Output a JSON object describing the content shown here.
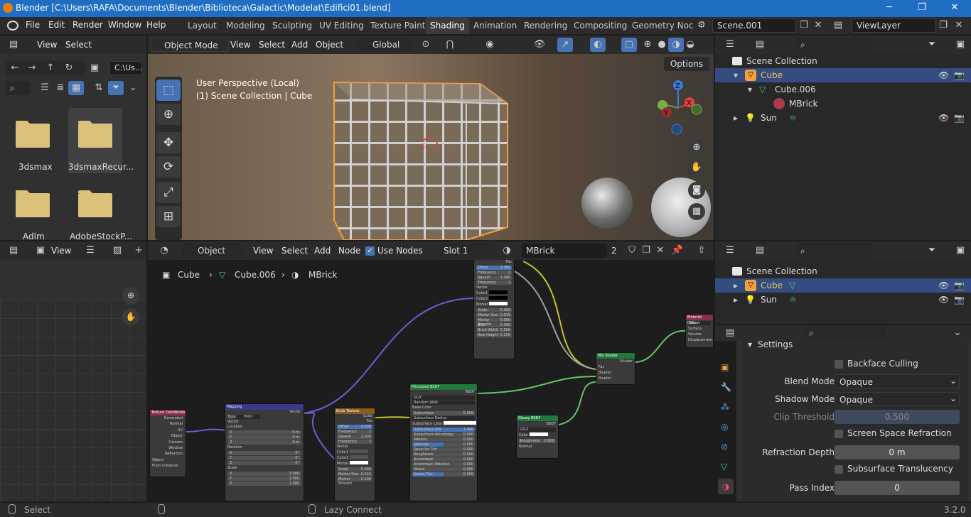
{
  "titlebar": {
    "title": "Blender [C:\\Users\\RAFA\\Documents\\Blender\\Biblioteca\\Galactic\\Modelat\\Edifici01.blend]",
    "minimize": "─",
    "maximize": "❐",
    "close": "✕"
  },
  "menu": [
    "File",
    "Edit",
    "Render",
    "Window",
    "Help"
  ],
  "workspaces": [
    "Layout",
    "Modeling",
    "Sculpting",
    "UV Editing",
    "Texture Paint",
    "Shading",
    "Animation",
    "Rendering",
    "Compositing",
    "Geometry Noc"
  ],
  "active_workspace": "Shading",
  "scene": "Scene.001",
  "viewlayer": "ViewLayer",
  "filebrowser": {
    "view": "View",
    "select": "Select",
    "path": "C:\\Us...",
    "folders": [
      "3dsmax",
      "3dsmaxRecur...",
      "Adlm",
      "AdobeStockP..."
    ]
  },
  "viewport": {
    "mode": "Object Mode",
    "menus": [
      "View",
      "Select",
      "Add",
      "Object"
    ],
    "transform": "Global",
    "options": "Options",
    "info1": "User Perspective (Local)",
    "info2": "(1) Scene Collection | Cube",
    "gizmo": {
      "x": "X",
      "y": "Y",
      "z": "Z"
    }
  },
  "outliner_top": {
    "scene_collection": "Scene Collection",
    "cube": "Cube",
    "mesh": "Cube.006",
    "material": "MBrick",
    "sun": "Sun"
  },
  "outliner_bottom": {
    "scene_collection": "Scene Collection",
    "cube": "Cube",
    "sun": "Sun"
  },
  "image_editor": {
    "view": "View"
  },
  "node_editor": {
    "type": "Object",
    "menus": [
      "View",
      "Select",
      "Add",
      "Node"
    ],
    "use_nodes": "Use Nodes",
    "slot": "Slot 1",
    "material": "MBrick",
    "users": "2",
    "breadcrumb": [
      "Cube",
      "Cube.006",
      "MBrick"
    ]
  },
  "nodes": {
    "texcoord": {
      "title": "Texture Coordinate",
      "rows": [
        "Generated",
        "Normal",
        "UV",
        "Object",
        "Camera",
        "Window",
        "Reflection",
        "Object",
        "From Instancer"
      ]
    },
    "mapping": {
      "title": "Mapping",
      "rows": [
        "Vector",
        "Type",
        "Point",
        "Vector",
        "Location",
        "X",
        "Y",
        "Z",
        "Rotation",
        "X",
        "Y",
        "Z",
        "Scale",
        "X",
        "Y",
        "Z"
      ],
      "vals": [
        "0 m",
        "0 m",
        "0 m",
        "0°",
        "0°",
        "0°",
        "1.000",
        "1.000",
        "1.000"
      ]
    },
    "brick1": {
      "title": "Brick Texture",
      "rows": [
        "Color",
        "Fac",
        "Offset",
        "Frequency",
        "Squash",
        "Frequency",
        "Vector",
        "Color1",
        "Color2",
        "Mortar",
        "Scale",
        "Mortar Size",
        "Mortar Smooth"
      ],
      "vals": [
        "0.500",
        "2",
        "1.000",
        "2",
        "5.000",
        "0.015",
        "0.100"
      ]
    },
    "brick2": {
      "title": "",
      "rows": [
        "Fac",
        "Offset",
        "Frequency",
        "Squash",
        "Frequency",
        "Vector",
        "Color1",
        "Color2",
        "Mortar",
        "Scale",
        "Mortar Size",
        "Mortar Smooth",
        "Bias",
        "Brick Width",
        "Row Height"
      ],
      "vals": [
        "1.000",
        "2",
        "1.000",
        "2",
        "5.000",
        "0.015",
        "0.000",
        "0.000",
        "0.500",
        "0.250"
      ]
    },
    "principled": {
      "title": "Principled BSDF",
      "rows": [
        "BSDF",
        "GGX",
        "Random Walk",
        "Base Color",
        "Subsurface",
        "Subsurface Radius",
        "Subsurface Color",
        "Subsurface IOR",
        "Subsurface Anisotropy",
        "Metallic",
        "Specular",
        "Specular Tint",
        "Roughness",
        "Anisotropic",
        "Anisotropic Rotation",
        "Sheen",
        "Sheen Tint"
      ],
      "vals": [
        "0.000",
        "1.400",
        "0.000",
        "0.000",
        "0.500",
        "0.000",
        "0.500",
        "0.000",
        "0.000",
        "0.000",
        "0.500"
      ]
    },
    "glossy": {
      "title": "Glossy BSDF",
      "rows": [
        "BSDF",
        "GGX",
        "Color",
        "Roughness",
        "Normal"
      ],
      "vals": [
        "0.000"
      ]
    },
    "mix": {
      "title": "Mix Shader",
      "rows": [
        "Shader",
        "Fac",
        "Shader",
        "Shader"
      ]
    },
    "output": {
      "title": "Material Output",
      "rows": [
        "All",
        "Surface",
        "Volume",
        "Displacement"
      ]
    }
  },
  "properties": {
    "section": "Settings",
    "backface_culling": "Backface Culling",
    "blend_mode_label": "Blend Mode",
    "blend_mode": "Opaque",
    "shadow_mode_label": "Shadow Mode",
    "shadow_mode": "Opaque",
    "clip_label": "Clip Threshold",
    "clip": "0.500",
    "ssr": "Screen Space Refraction",
    "refraction_depth_label": "Refraction Depth",
    "refraction_depth": "0 m",
    "sss": "Subsurface Translucency",
    "pass_index_label": "Pass Index",
    "pass_index": "0"
  },
  "statusbar": {
    "left": "Select",
    "middle": "Lazy Connect",
    "version": "3.2.0"
  },
  "colors": {
    "accent": "#4772b3",
    "selected_row": "#334d80",
    "object_orange": "#f5a03a",
    "mesh_green": "#4dcc7a"
  }
}
